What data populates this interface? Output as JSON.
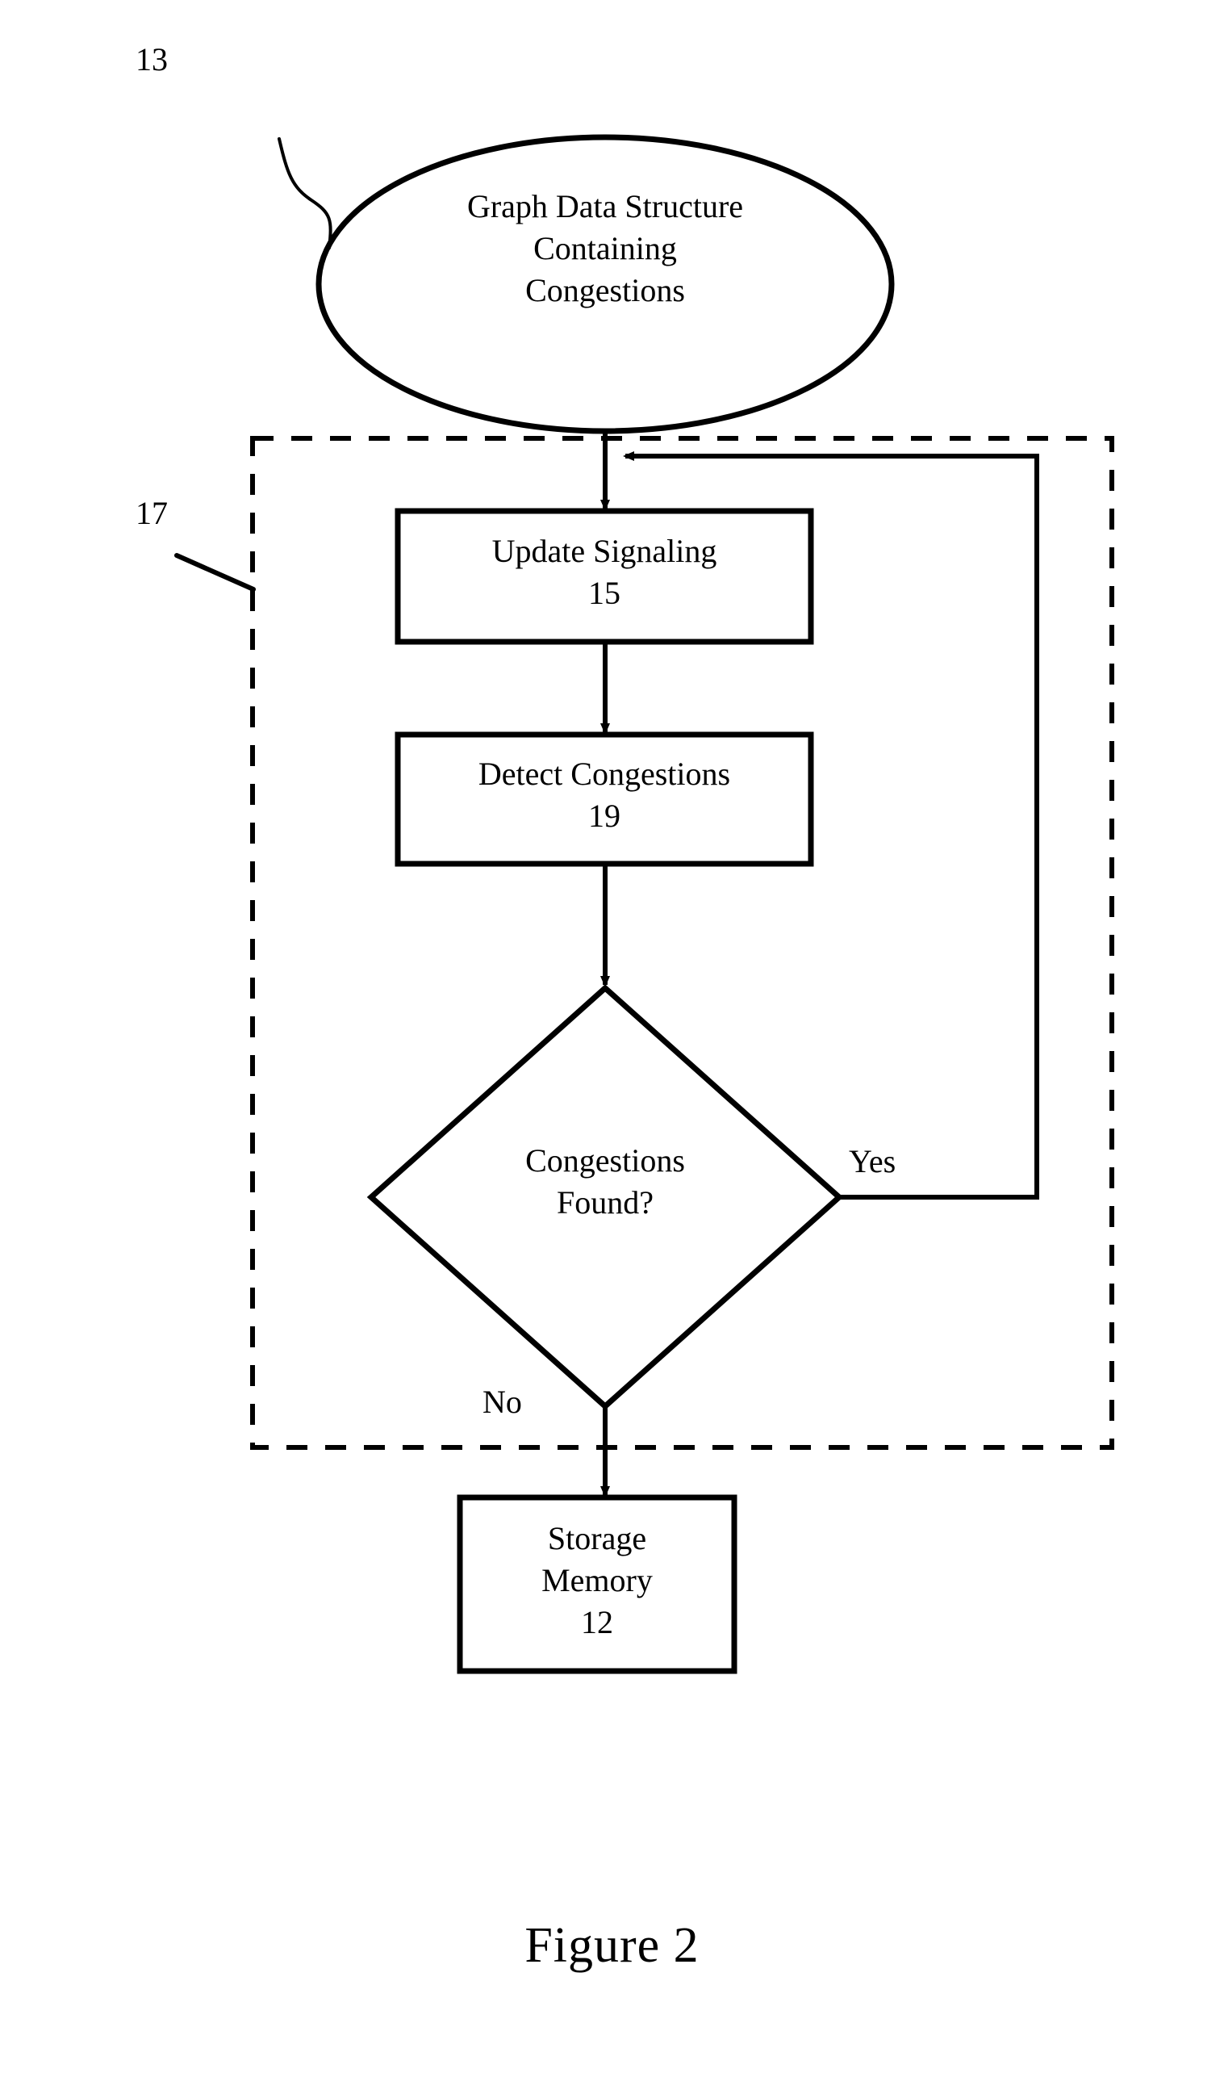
{
  "figure": {
    "caption": "Figure 2",
    "type": "flowchart"
  },
  "nodes": {
    "start_ellipse": {
      "shape": "ellipse",
      "text": "Graph Data Structure\nContaining\nCongestions",
      "reference_numeral": "13"
    },
    "process_update": {
      "shape": "rectangle",
      "text": "Update Signaling\n15",
      "label": "Update Signaling",
      "reference_numeral": "15"
    },
    "process_detect": {
      "shape": "rectangle",
      "text": "Detect Congestions\n19",
      "label": "Detect Congestions",
      "reference_numeral": "19"
    },
    "decision": {
      "shape": "diamond",
      "text": "Congestions\nFound?",
      "label": "Congestions Found?"
    },
    "storage": {
      "shape": "rectangle",
      "text": "Storage\nMemory\n12",
      "label": "Storage Memory",
      "reference_numeral": "12"
    }
  },
  "group": {
    "dashed_region_reference_numeral": "17",
    "style": "dashed"
  },
  "edges": {
    "yes_label": "Yes",
    "no_label": "No"
  },
  "colors": {
    "stroke": "#000000",
    "background": "#ffffff",
    "text": "#000000"
  }
}
